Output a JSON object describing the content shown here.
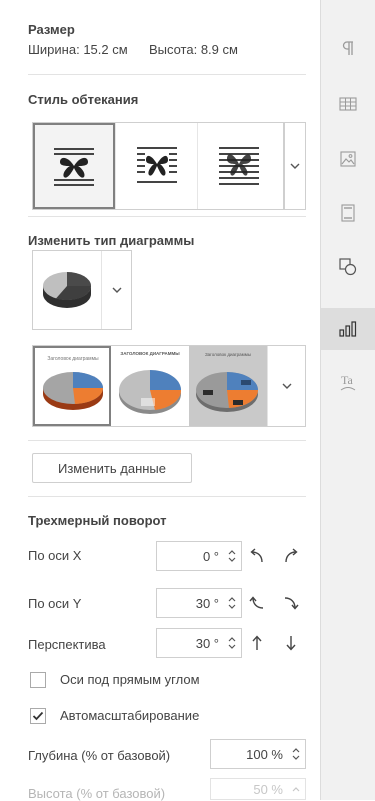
{
  "size": {
    "title": "Размер",
    "width_label": "Ширина:",
    "width_value": "15.2 см",
    "height_label": "Высота:",
    "height_value": "8.9 см"
  },
  "wrapping": {
    "title": "Стиль обтекания",
    "options": [
      "wrap-top-bottom",
      "wrap-square",
      "wrap-inline"
    ],
    "selected_index": 0
  },
  "chart_type": {
    "title": "Изменить тип диаграммы",
    "current": "pie-3d"
  },
  "chart_styles": {
    "items": [
      {
        "caption": "Заголовок диаграммы"
      },
      {
        "caption": "ЗАГОЛОВОК ДИАГРАММЫ"
      },
      {
        "caption": "Заголовок диаграммы"
      }
    ],
    "selected_index": 0
  },
  "edit_data_button": "Изменить данные",
  "rotation": {
    "title": "Трехмерный поворот",
    "x_label": "По оси X",
    "x_value": "0 °",
    "y_label": "По оси Y",
    "y_value": "30 °",
    "perspective_label": "Перспектива",
    "perspective_value": "30 °"
  },
  "right_angle_axes": {
    "label": "Оси под прямым углом",
    "checked": false
  },
  "autoscale": {
    "label": "Автомасштабирование",
    "checked": true
  },
  "depth": {
    "label": "Глубина (% от базовой)",
    "value": "100 %"
  },
  "height_pct": {
    "label": "Высота (% от базовой)",
    "value": "50 %",
    "disabled": true
  },
  "rail": {
    "items": [
      "paragraph-icon",
      "table-icon",
      "image-icon",
      "header-footer-icon",
      "shape-icon",
      "chart-icon",
      "text-art-icon"
    ],
    "active_index": 5
  },
  "colors": {
    "pie_blue": "#4f81bd",
    "pie_orange": "#ed7d31",
    "pie_gray": "#a5a5a5",
    "pie_dark": "#3f3f3f"
  }
}
